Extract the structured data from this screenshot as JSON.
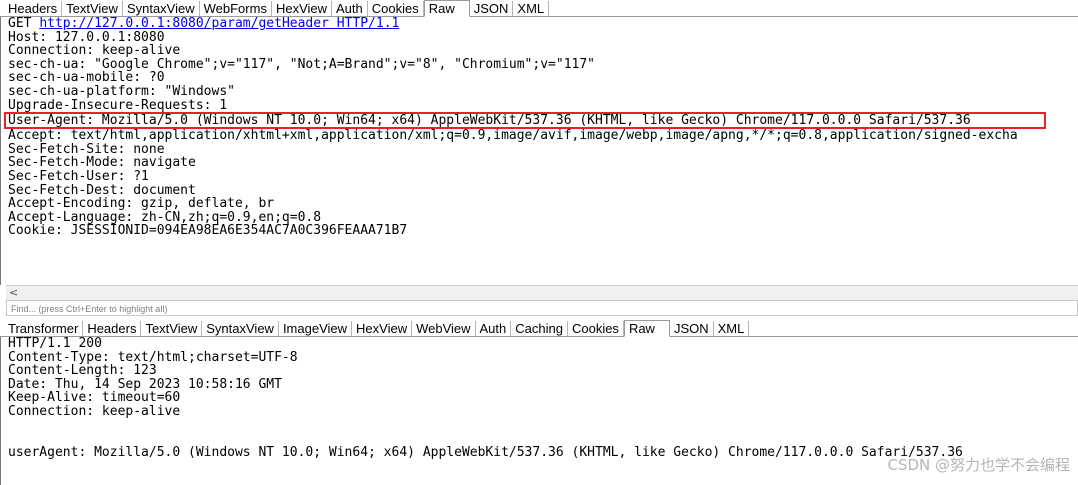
{
  "request": {
    "tabs": [
      "Headers",
      "TextView",
      "SyntaxView",
      "WebForms",
      "HexView",
      "Auth",
      "Cookies",
      "Raw",
      "JSON",
      "XML"
    ],
    "active_tab": "Raw",
    "request_line": {
      "method": "GET ",
      "url": "http://127.0.0.1:8080/param/getHeader",
      "protocol": " HTTP/1.1"
    },
    "lines_before": [
      "Host: 127.0.0.1:8080",
      "Connection: keep-alive",
      "sec-ch-ua: \"Google Chrome\";v=\"117\", \"Not;A=Brand\";v=\"8\", \"Chromium\";v=\"117\"",
      "sec-ch-ua-mobile: ?0",
      "sec-ch-ua-platform: \"Windows\"",
      "Upgrade-Insecure-Requests: 1"
    ],
    "highlighted_line": "User-Agent: Mozilla/5.0 (Windows NT 10.0; Win64; x64) AppleWebKit/537.36 (KHTML, like Gecko) Chrome/117.0.0.0 Safari/537.36",
    "lines_after": [
      "Accept: text/html,application/xhtml+xml,application/xml;q=0.9,image/avif,image/webp,image/apng,*/*;q=0.8,application/signed-excha",
      "Sec-Fetch-Site: none",
      "Sec-Fetch-Mode: navigate",
      "Sec-Fetch-User: ?1",
      "Sec-Fetch-Dest: document",
      "Accept-Encoding: gzip, deflate, br",
      "Accept-Language: zh-CN,zh;q=0.9,en;q=0.8",
      "Cookie: JSESSIONID=094EA98EA6E354AC7A0C396FEAAA71B7"
    ],
    "scroll_left_glyph": "<",
    "find_placeholder": "Find... (press Ctrl+Enter to highlight all)"
  },
  "response": {
    "tabs": [
      "Transformer",
      "Headers",
      "TextView",
      "SyntaxView",
      "ImageView",
      "HexView",
      "WebView",
      "Auth",
      "Caching",
      "Cookies",
      "Raw",
      "JSON",
      "XML"
    ],
    "active_tab": "Raw",
    "header_lines": [
      "HTTP/1.1 200",
      "Content-Type: text/html;charset=UTF-8",
      "Content-Length: 123",
      "Date: Thu, 14 Sep 2023 10:58:16 GMT",
      "Keep-Alive: timeout=60",
      "Connection: keep-alive"
    ],
    "body_line": "userAgent: Mozilla/5.0 (Windows NT 10.0; Win64; x64) AppleWebKit/537.36 (KHTML, like Gecko) Chrome/117.0.0.0 Safari/537.36"
  },
  "watermark": "CSDN @努力也学不会编程",
  "colors": {
    "highlight_border": "#e8202a",
    "link": "#0000ee"
  }
}
